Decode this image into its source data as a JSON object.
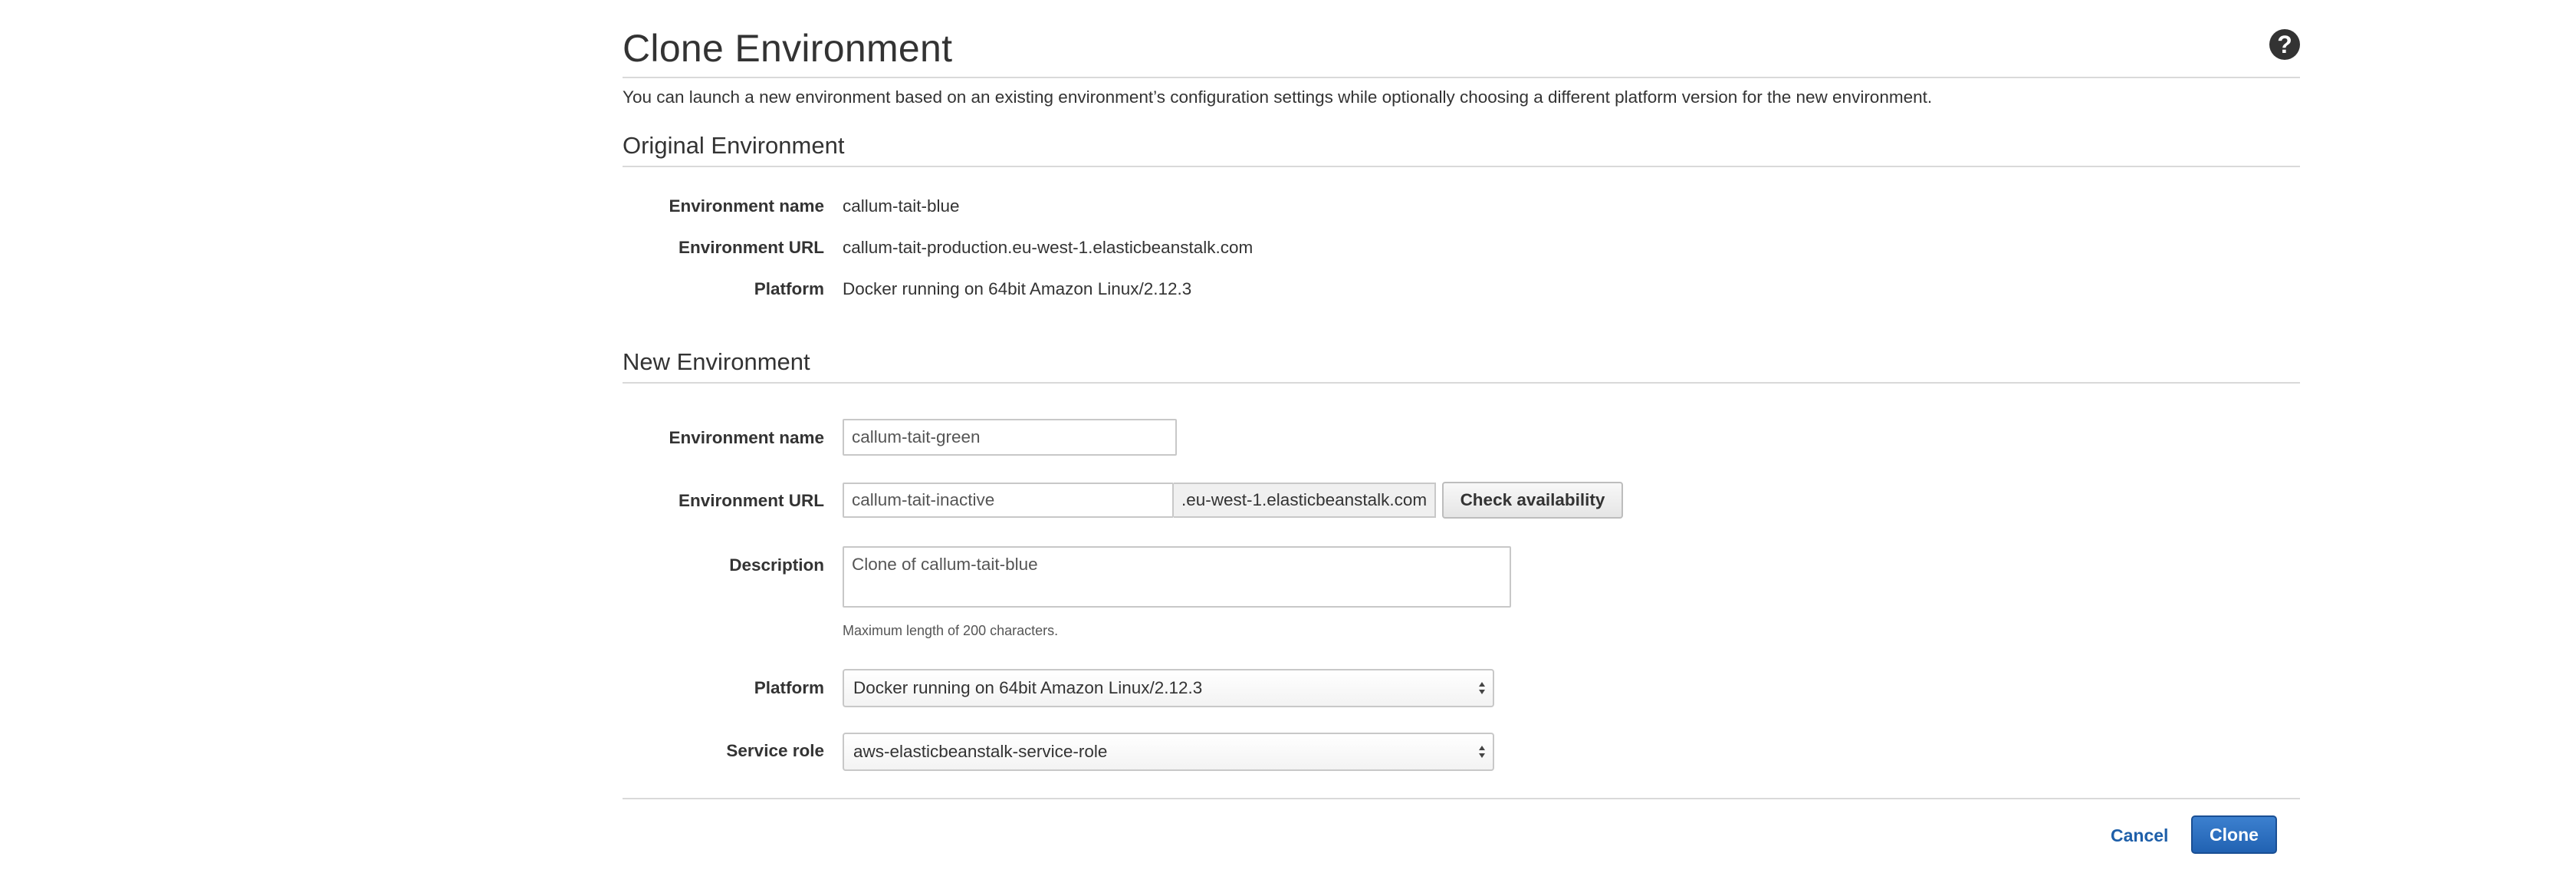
{
  "page": {
    "title": "Clone Environment",
    "intro": "You can launch a new environment based on an existing environment’s configuration settings while optionally choosing a different platform version for the new environment."
  },
  "help": {
    "icon": "question-mark-icon",
    "glyph": "?"
  },
  "original": {
    "heading": "Original Environment",
    "env_name_label": "Environment name",
    "env_name_value": "callum-tait-blue",
    "env_url_label": "Environment URL",
    "env_url_value": "callum-tait-production.eu-west-1.elasticbeanstalk.com",
    "platform_label": "Platform",
    "platform_value": "Docker running on 64bit Amazon Linux/2.12.3"
  },
  "new_env": {
    "heading": "New Environment",
    "env_name_label": "Environment name",
    "env_name_value": "callum-tait-green",
    "env_url_label": "Environment URL",
    "env_url_value": "callum-tait-inactive",
    "env_url_suffix": ".eu-west-1.elasticbeanstalk.com",
    "check_availability_label": "Check availability",
    "description_label": "Description",
    "description_value": "Clone of callum-tait-blue",
    "description_hint": "Maximum length of 200 characters.",
    "platform_label": "Platform",
    "platform_selected": "Docker running on 64bit Amazon Linux/2.12.3",
    "service_role_label": "Service role",
    "service_role_selected": "aws-elasticbeanstalk-service-role"
  },
  "actions": {
    "cancel_label": "Cancel",
    "clone_label": "Clone"
  },
  "colors": {
    "primary_button": "#2a6bbf",
    "link": "#1e5fa9",
    "rule": "#d9d9d9"
  }
}
